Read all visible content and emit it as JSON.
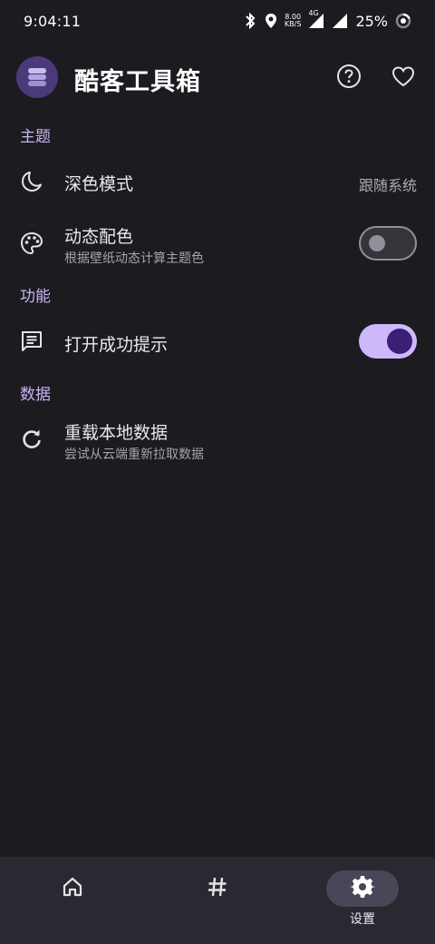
{
  "status_bar": {
    "time": "9:04:11",
    "net_speed_value": "8.00",
    "net_speed_unit": "KB/S",
    "network_type": "4G",
    "battery": "25%"
  },
  "app_bar": {
    "title": "酷客工具箱",
    "help_icon": "help-circle-icon",
    "favorite_icon": "heart-icon"
  },
  "sections": {
    "theme": "主题",
    "features": "功能",
    "data": "数据"
  },
  "items": {
    "dark_mode": {
      "title": "深色模式",
      "value": "跟随系统",
      "icon": "moon-icon"
    },
    "dynamic_color": {
      "title": "动态配色",
      "subtitle": "根据壁纸动态计算主题色",
      "icon": "palette-icon",
      "enabled": false
    },
    "open_success_tip": {
      "title": "打开成功提示",
      "icon": "message-icon",
      "enabled": true
    },
    "reload_data": {
      "title": "重载本地数据",
      "subtitle": "尝试从云端重新拉取数据",
      "icon": "refresh-icon"
    }
  },
  "bottom_nav": {
    "items": [
      {
        "icon": "home-icon",
        "label": "",
        "active": false
      },
      {
        "icon": "hash-icon",
        "label": "",
        "active": false
      },
      {
        "icon": "gear-icon",
        "label": "设置",
        "active": true
      }
    ]
  },
  "colors": {
    "background": "#1c1b1f",
    "accent": "#c8b4f4",
    "toggle_on": "#cdb8fb",
    "nav_background": "#2a2831"
  }
}
